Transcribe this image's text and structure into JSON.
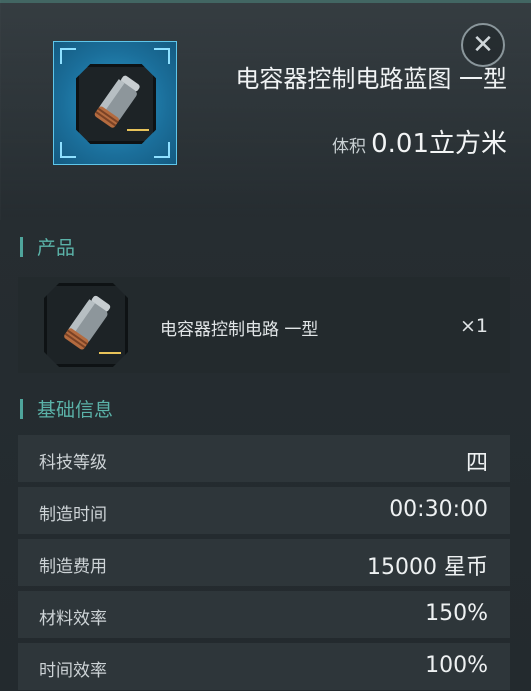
{
  "header": {
    "title": "电容器控制电路蓝图 一型",
    "volume_label": "体积",
    "volume_value": "0.01立方米",
    "close_icon": "close-icon"
  },
  "sections": {
    "product_title": "产品",
    "info_title": "基础信息"
  },
  "product": {
    "name": "电容器控制电路 一型",
    "quantity": "×1",
    "icon": "capacitor-icon"
  },
  "info": [
    {
      "label": "科技等级",
      "value": "四"
    },
    {
      "label": "制造时间",
      "value": "00:30:00"
    },
    {
      "label": "制造费用",
      "value": "15000 星币"
    },
    {
      "label": "材料效率",
      "value": "150%"
    },
    {
      "label": "时间效率",
      "value": "100%"
    }
  ]
}
